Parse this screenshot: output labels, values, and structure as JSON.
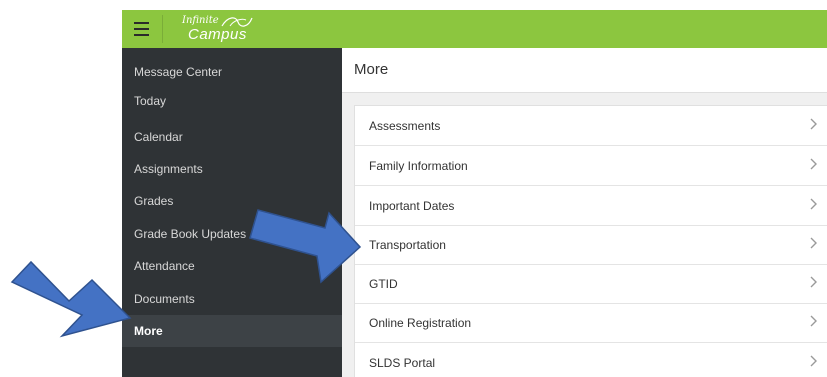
{
  "app": {
    "logo_small": "Infinite",
    "logo_large": "Campus",
    "topbar_color": "#8cc63f"
  },
  "sidebar": {
    "items": [
      {
        "label": "Message Center"
      },
      {
        "label": "Today"
      },
      {
        "label": "Calendar"
      },
      {
        "label": "Assignments"
      },
      {
        "label": "Grades"
      },
      {
        "label": "Grade Book Updates"
      },
      {
        "label": "Attendance"
      },
      {
        "label": "Documents"
      },
      {
        "label": "More",
        "active": true
      }
    ]
  },
  "main": {
    "title": "More",
    "items": [
      {
        "label": "Assessments",
        "icon": "chevron-right-icon"
      },
      {
        "label": "Family Information",
        "icon": "chevron-right-icon"
      },
      {
        "label": "Important Dates",
        "icon": "chevron-right-icon"
      },
      {
        "label": "Transportation",
        "icon": "chevron-right-icon"
      },
      {
        "label": "GTID",
        "icon": "chevron-right-icon"
      },
      {
        "label": "Online Registration",
        "icon": "chevron-right-icon"
      },
      {
        "label": "SLDS Portal",
        "icon": "chevron-right-icon"
      }
    ]
  },
  "annotations": {
    "arrow_color": "#4472c4"
  }
}
